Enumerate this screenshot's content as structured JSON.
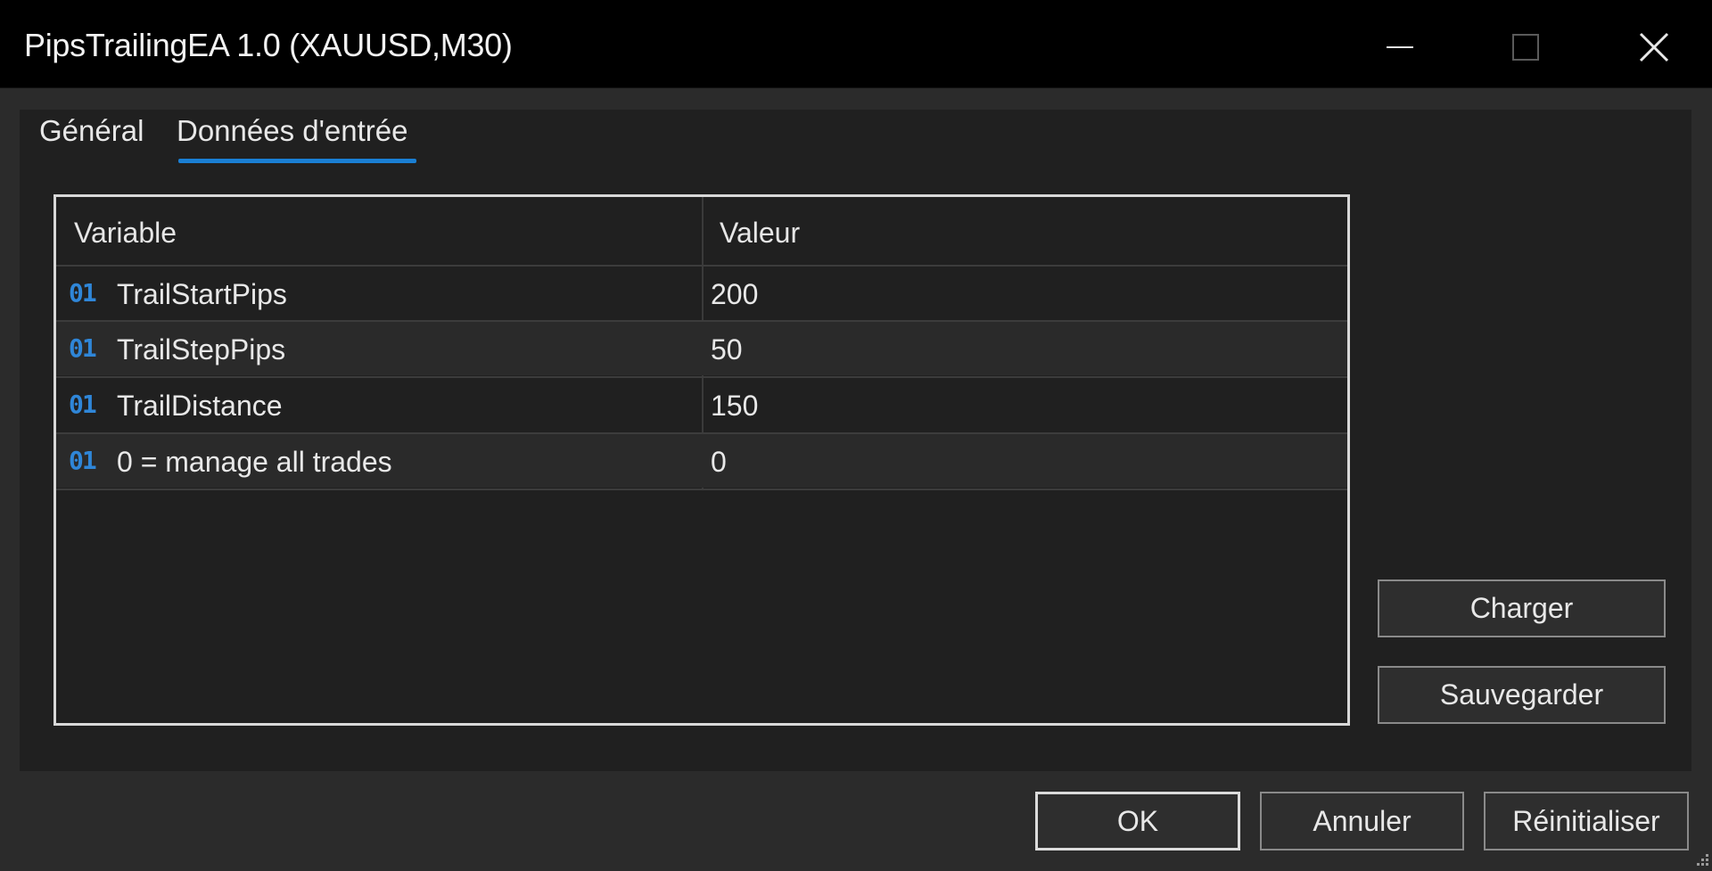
{
  "window": {
    "title": "PipsTrailingEA 1.0 (XAUUSD,M30)"
  },
  "tabs": [
    {
      "label": "Général",
      "active": false
    },
    {
      "label": "Données d'entrée",
      "active": true
    }
  ],
  "grid": {
    "columns": {
      "variable": "Variable",
      "value": "Valeur"
    },
    "rows": [
      {
        "type_icon": "01",
        "name": "TrailStartPips",
        "value": "200"
      },
      {
        "type_icon": "01",
        "name": "TrailStepPips",
        "value": "50"
      },
      {
        "type_icon": "01",
        "name": "TrailDistance",
        "value": "150"
      },
      {
        "type_icon": "01",
        "name": "0 = manage all trades",
        "value": "0"
      }
    ]
  },
  "side_buttons": {
    "load": "Charger",
    "save": "Sauvegarder"
  },
  "footer_buttons": {
    "ok": "OK",
    "cancel": "Annuler",
    "reset": "Réinitialiser"
  },
  "colors": {
    "accent": "#1a7fd4",
    "type_icon": "#2f86d8",
    "titlebar": "#000000",
    "panel": "#202020",
    "background": "#2b2b2b"
  },
  "icons": {
    "minimize": "minimize-icon",
    "maximize": "maximize-icon",
    "close": "close-icon",
    "resize_grip": "resize-grip-icon"
  }
}
